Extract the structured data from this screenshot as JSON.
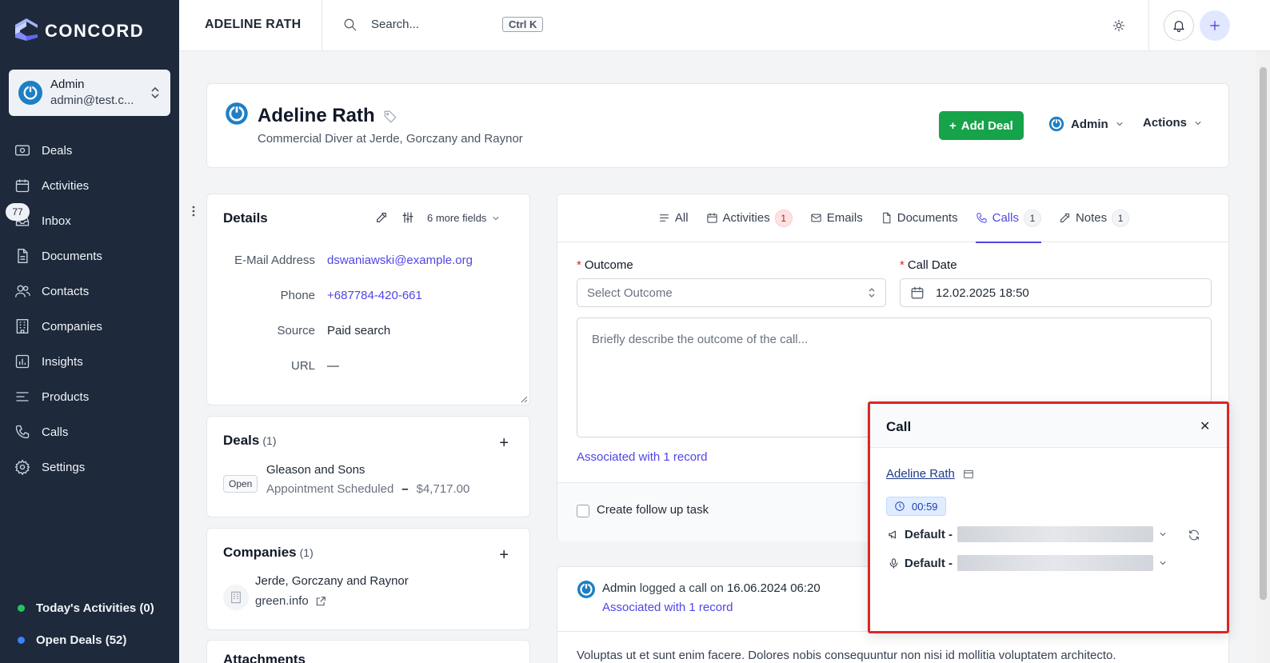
{
  "sidebar": {
    "brand": "CONCORD",
    "user": {
      "name": "Admin",
      "email": "admin@test.c..."
    },
    "nav": [
      {
        "label": "Deals",
        "icon": "deals-icon"
      },
      {
        "label": "Activities",
        "icon": "calendar-icon"
      },
      {
        "label": "Inbox",
        "icon": "inbox-icon",
        "badge": "77"
      },
      {
        "label": "Documents",
        "icon": "document-icon"
      },
      {
        "label": "Contacts",
        "icon": "users-icon"
      },
      {
        "label": "Companies",
        "icon": "building-icon"
      },
      {
        "label": "Insights",
        "icon": "chart-icon"
      },
      {
        "label": "Products",
        "icon": "list-icon"
      },
      {
        "label": "Calls",
        "icon": "phone-icon"
      },
      {
        "label": "Settings",
        "icon": "gear-icon"
      }
    ],
    "footer": {
      "todays_activities": "Today's Activities (0)",
      "open_deals": "Open Deals (52)"
    },
    "colors": {
      "bg": "#1e293b",
      "green_dot": "#22c55e",
      "blue_dot": "#3b82f6"
    }
  },
  "topbar": {
    "title": "ADELINE RATH",
    "search_placeholder": "Search...",
    "shortcut": "Ctrl K"
  },
  "contact": {
    "name": "Adeline Rath",
    "subtitle": "Commercial Diver at Jerde, Gorczany and Raynor",
    "add_deal": "Add Deal",
    "owner": "Admin",
    "actions": "Actions"
  },
  "details": {
    "title": "Details",
    "more_fields": "6 more fields",
    "fields": [
      {
        "label": "E-Mail Address",
        "value": "dswaniawski@example.org"
      },
      {
        "label": "Phone",
        "value": "+687784-420-661"
      },
      {
        "label": "Source",
        "value": "Paid search"
      },
      {
        "label": "URL",
        "value": "—"
      }
    ]
  },
  "deals": {
    "title": "Deals",
    "count": "(1)",
    "items": [
      {
        "status": "Open",
        "name": "Gleason and Sons",
        "stage": "Appointment Scheduled",
        "separator": "–",
        "amount": "$4,717.00"
      }
    ]
  },
  "companies": {
    "title": "Companies",
    "count": "(1)",
    "items": [
      {
        "name": "Jerde, Gorczany and Raynor",
        "domain": "green.info"
      }
    ]
  },
  "attachments": {
    "title": "Attachments"
  },
  "tabs": [
    {
      "label": "All",
      "icon": "list-icon"
    },
    {
      "label": "Activities",
      "icon": "calendar-icon",
      "count": "1"
    },
    {
      "label": "Emails",
      "icon": "mail-icon"
    },
    {
      "label": "Documents",
      "icon": "document-icon"
    },
    {
      "label": "Calls",
      "icon": "phone-icon",
      "count": "1",
      "active": true
    },
    {
      "label": "Notes",
      "icon": "edit-icon",
      "count": "1"
    }
  ],
  "call_form": {
    "outcome_label": "Outcome",
    "outcome_placeholder": "Select Outcome",
    "date_label": "Call Date",
    "date_value": "12.02.2025 18:50",
    "description_placeholder": "Briefly describe the outcome of the call...",
    "associated": "Associated with 1 record",
    "follow_up": "Create follow up task",
    "required_mark": "*"
  },
  "log": {
    "user": "Admin",
    "action": "logged a call on",
    "date": "16.06.2024 06:20",
    "associated": "Associated with 1 record",
    "body": "Voluptas ut et sunt enim facere. Dolores nobis consequuntur non nisi id mollitia voluptatem architecto."
  },
  "call_popup": {
    "title": "Call",
    "contact": "Adeline Rath",
    "timer": "00:59",
    "speaker_label": "Default -",
    "mic_label": "Default -"
  }
}
